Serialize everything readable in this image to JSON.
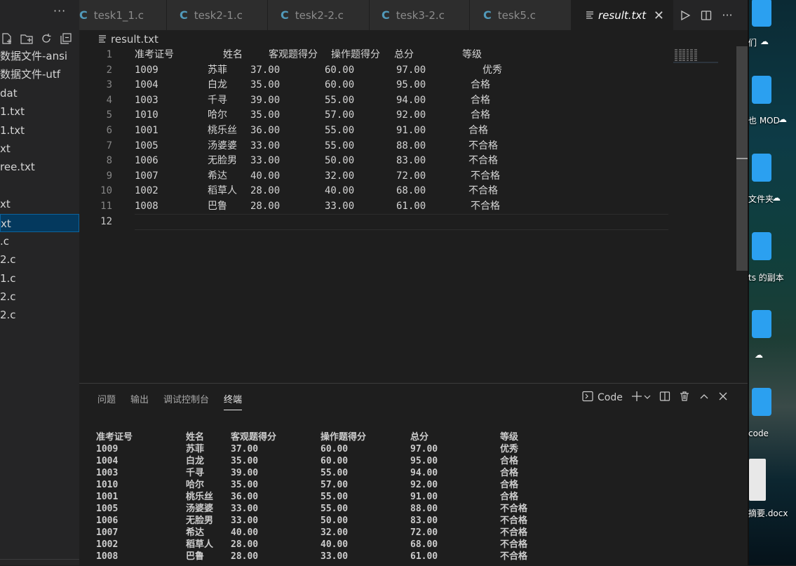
{
  "sidebar": {
    "more_label": "···",
    "files": [
      "数据文件-ansi",
      "数据文件-utf",
      "dat",
      "1.txt",
      "1.txt",
      "xt",
      "ree.txt",
      "",
      "xt",
      "xt",
      ".c",
      "2.c",
      "1.c",
      "2.c",
      "2.c"
    ],
    "active_index": 9
  },
  "tabs": [
    {
      "label": "tesk1_1.c",
      "type": "c"
    },
    {
      "label": "tesk2-1.c",
      "type": "c"
    },
    {
      "label": "tesk2-2.c",
      "type": "c"
    },
    {
      "label": "tesk3-2.c",
      "type": "c"
    },
    {
      "label": "tesk5.c",
      "type": "c"
    },
    {
      "label": "result.txt",
      "type": "txt",
      "active": true
    }
  ],
  "tab_close": "✕",
  "breadcrumb": "result.txt",
  "editor": {
    "line_numbers": [
      "1",
      "2",
      "3",
      "4",
      "5",
      "6",
      "7",
      "8",
      "9",
      "10",
      "11",
      "12"
    ],
    "header": [
      "准考证号",
      "姓名",
      "客观题得分",
      "操作题得分",
      "总分",
      "等级"
    ],
    "rows": [
      [
        "1009",
        "苏菲",
        "37.00",
        "60.00",
        "97.00",
        "优秀"
      ],
      [
        "1004",
        "白龙",
        "35.00",
        "60.00",
        "95.00",
        "合格"
      ],
      [
        "1003",
        "千寻",
        "39.00",
        "55.00",
        "94.00",
        "合格"
      ],
      [
        "1010",
        "哈尔",
        "35.00",
        "57.00",
        "92.00",
        "合格"
      ],
      [
        "1001",
        "桃乐丝",
        "36.00",
        "55.00",
        "91.00",
        "合格"
      ],
      [
        "1005",
        "汤婆婆",
        "33.00",
        "55.00",
        "88.00",
        "不合格"
      ],
      [
        "1006",
        "无脸男",
        "33.00",
        "50.00",
        "83.00",
        "不合格"
      ],
      [
        "1007",
        "希达",
        "40.00",
        "32.00",
        "72.00",
        "不合格"
      ],
      [
        "1002",
        "稻草人",
        "28.00",
        "40.00",
        "68.00",
        "不合格"
      ],
      [
        "1008",
        "巴鲁",
        "28.00",
        "33.00",
        "61.00",
        "不合格"
      ]
    ]
  },
  "panel": {
    "tabs": [
      "问题",
      "输出",
      "调试控制台",
      "终端"
    ],
    "active_tab": 3,
    "terminal_profile": "Code",
    "terminal": {
      "header": [
        "准考证号",
        "姓名",
        "客观题得分",
        "操作题得分",
        "总分",
        "等级"
      ],
      "rows": [
        [
          "1009",
          "苏菲",
          "37.00",
          "60.00",
          "97.00",
          "优秀"
        ],
        [
          "1004",
          "白龙",
          "35.00",
          "60.00",
          "95.00",
          "合格"
        ],
        [
          "1003",
          "千寻",
          "39.00",
          "55.00",
          "94.00",
          "合格"
        ],
        [
          "1010",
          "哈尔",
          "35.00",
          "57.00",
          "92.00",
          "合格"
        ],
        [
          "1001",
          "桃乐丝",
          "36.00",
          "55.00",
          "91.00",
          "合格"
        ],
        [
          "1005",
          "汤婆婆",
          "33.00",
          "55.00",
          "88.00",
          "不合格"
        ],
        [
          "1006",
          "无脸男",
          "33.00",
          "50.00",
          "83.00",
          "不合格"
        ],
        [
          "1007",
          "希达",
          "40.00",
          "32.00",
          "72.00",
          "不合格"
        ],
        [
          "1002",
          "稻草人",
          "28.00",
          "40.00",
          "68.00",
          "不合格"
        ],
        [
          "1008",
          "巴鲁",
          "28.00",
          "33.00",
          "61.00",
          "不合格"
        ]
      ]
    }
  },
  "desktop": {
    "labels": [
      "们",
      "也 MOD",
      "文件夹",
      "ts 的副本",
      "",
      "code",
      "摘要.docx"
    ]
  },
  "colors": {
    "editor_bg": "#1e1e1e",
    "sidebar_bg": "#252526",
    "accent": "#0e639c",
    "c_icon": "#519aba",
    "folder": "#2ba0f0"
  }
}
